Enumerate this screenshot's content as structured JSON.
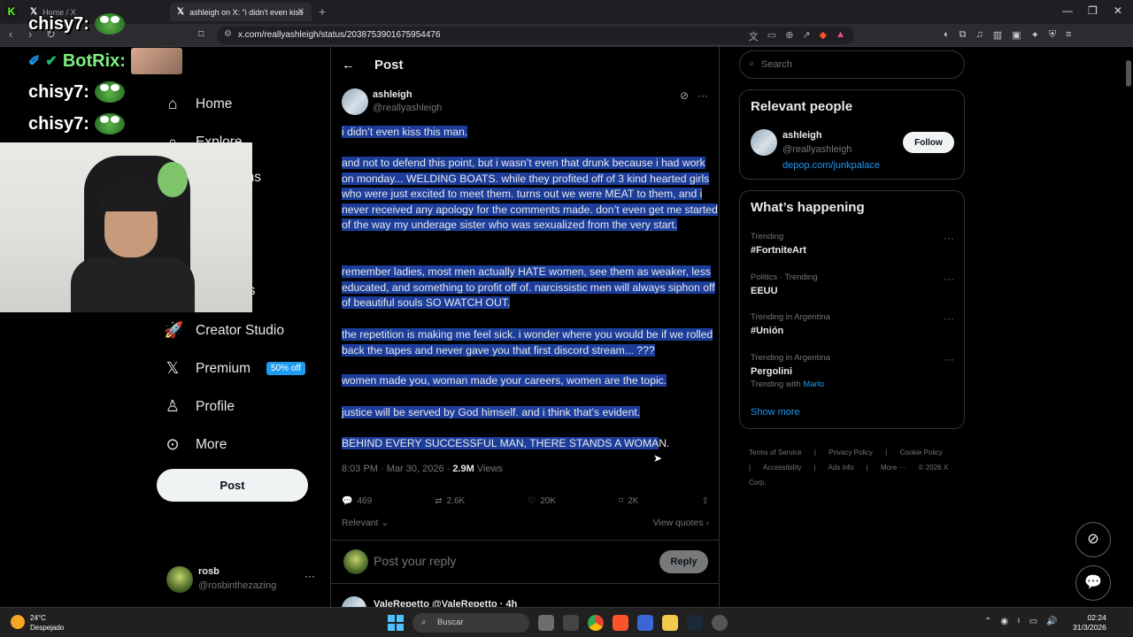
{
  "browser": {
    "tabs": [
      {
        "label": "Home / X"
      },
      {
        "label": "ashleigh on X: \"i didn't even kiss"
      }
    ],
    "url": "x.com/reallyashleigh/status/2038753901675954476"
  },
  "overlay": {
    "chat": [
      {
        "user": "chisy7:"
      },
      {
        "user": "BotRix:"
      },
      {
        "user": "chisy7:"
      },
      {
        "user": "chisy7:"
      }
    ]
  },
  "sidebar": {
    "items": [
      {
        "label": "Home",
        "icon": "home-icon"
      },
      {
        "label": "Explore",
        "icon": "search-icon"
      },
      {
        "label": "Notifications",
        "icon": "bell-icon"
      },
      {
        "label": "Bookmarks",
        "icon": "bookmark-icon"
      },
      {
        "label": "Creator Studio",
        "icon": "rocket-icon"
      },
      {
        "label": "Premium",
        "icon": "x-logo-icon",
        "badge": "50% off"
      },
      {
        "label": "Profile",
        "icon": "person-icon"
      },
      {
        "label": "More",
        "icon": "more-circle-icon"
      }
    ],
    "partial_labels": {
      "explore": "Explore",
      "notifications": "ons",
      "bookmarks": "ks"
    },
    "post_button": "Post",
    "account": {
      "name": "rosb",
      "handle": "@rosbinthezazing"
    }
  },
  "post": {
    "header": "Post",
    "author": {
      "name": "ashleigh",
      "handle": "@reallyashleigh"
    },
    "paragraphs": [
      "i didn’t even kiss this man.",
      "and not to defend this point, but i wasn’t even that drunk because i had work on monday... WELDING BOATS. while they profited off of 3 kind hearted girls who were just excited to meet them. turns out we were MEAT to them, and i never received any apology for the comments made. don’t even get me started of the way my underage sister who was sexualized from the very start.",
      "remember ladies, most men actually HATE women, see them as weaker, less educated, and something to profit off of. narcissistic men will always siphon off of beautiful souls SO WATCH OUT.",
      "the repetition is making me feel sick. i wonder where you would be if we rolled back the tapes and never gave you that first discord stream... ???",
      "women made you, woman made your careers, women are the topic.",
      "justice will be served by God himself. and i think that’s evident.",
      "BEHIND EVERY SUCCESSFUL MAN, THERE STANDS A WOMAN."
    ],
    "last_highlighted": "BEHIND EVERY SUCCESSFUL MAN, THERE STANDS A WOMA",
    "last_rest": "N.",
    "timestamp": "8:03 PM · Mar 30, 2026 · ",
    "views": "2.9M",
    "views_label": " Views",
    "stats": {
      "replies": "469",
      "reposts": "2.6K",
      "likes": "20K",
      "bookmarks": "2K"
    },
    "sort_label": "Relevant",
    "view_quotes": "View quotes",
    "reply_placeholder": "Post your reply",
    "reply_button": "Reply",
    "next_reply_author": "ValeRepetto @ValeRepetto · 4h"
  },
  "right": {
    "search_placeholder": "Search",
    "relevant_title": "Relevant people",
    "relevant_person": {
      "name": "ashleigh",
      "handle": "@reallyashleigh",
      "link": "depop.com/junkpalace",
      "follow": "Follow"
    },
    "happening_title": "What’s happening",
    "trends": [
      {
        "category": "Trending",
        "title": "#FortniteArt"
      },
      {
        "category": "Politics · Trending",
        "title": "EEUU"
      },
      {
        "category": "Trending in Argentina",
        "title": "#Unión"
      },
      {
        "category": "Trending in Argentina",
        "title": "Pergolini",
        "extra": "Trending with",
        "extra_link": "Marlo"
      }
    ],
    "show_more": "Show more",
    "footer": [
      "Terms of Service",
      "|",
      "Privacy Policy",
      "|",
      "Cookie Policy",
      "|",
      "Accessibility",
      "|",
      "Ads info",
      "|",
      "More ···",
      "© 2026 X Corp."
    ]
  },
  "taskbar": {
    "temp": "24°C",
    "weather": "Despejado",
    "search": "Buscar",
    "time": "02:24",
    "date": "31/3/2026"
  },
  "colors": {
    "accent": "#1d9bf0",
    "selection": "#1c3d99",
    "background": "#000000"
  }
}
